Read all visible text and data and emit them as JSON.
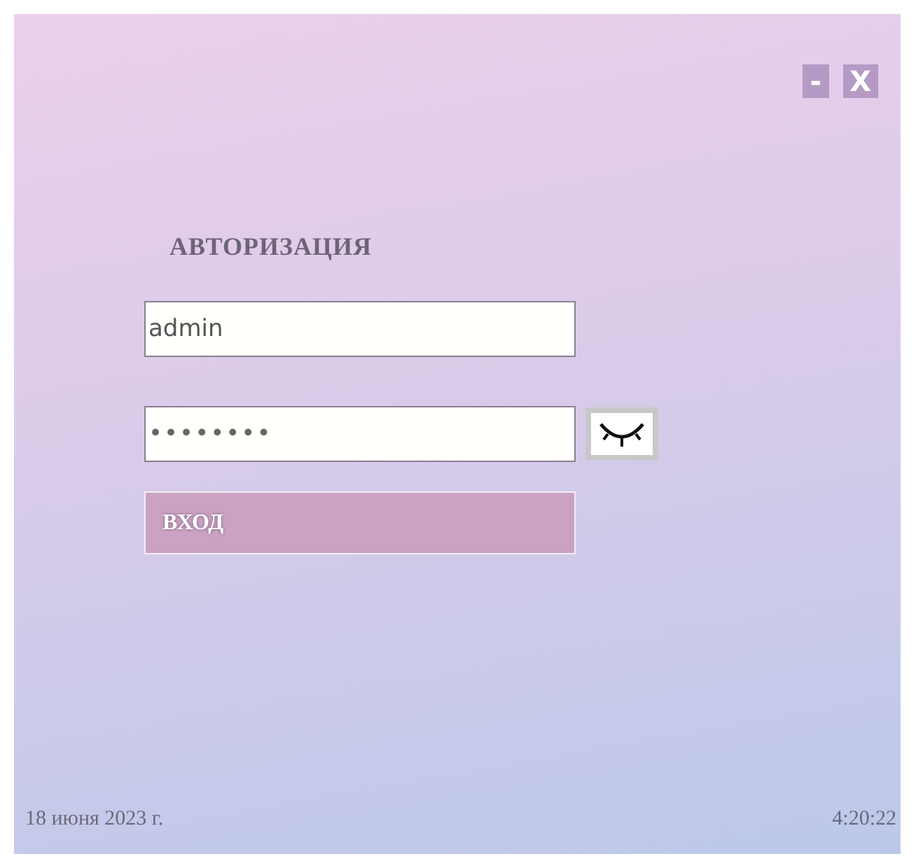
{
  "window": {
    "minimize": "-",
    "close": "X"
  },
  "title": "АВТОРИЗАЦИЯ",
  "login": {
    "value": "admin"
  },
  "password": {
    "value": "••••••••"
  },
  "submit": "ВХОД",
  "status_bar": {
    "date": "18 июня 2023 г.",
    "time": "4:20:22"
  }
}
